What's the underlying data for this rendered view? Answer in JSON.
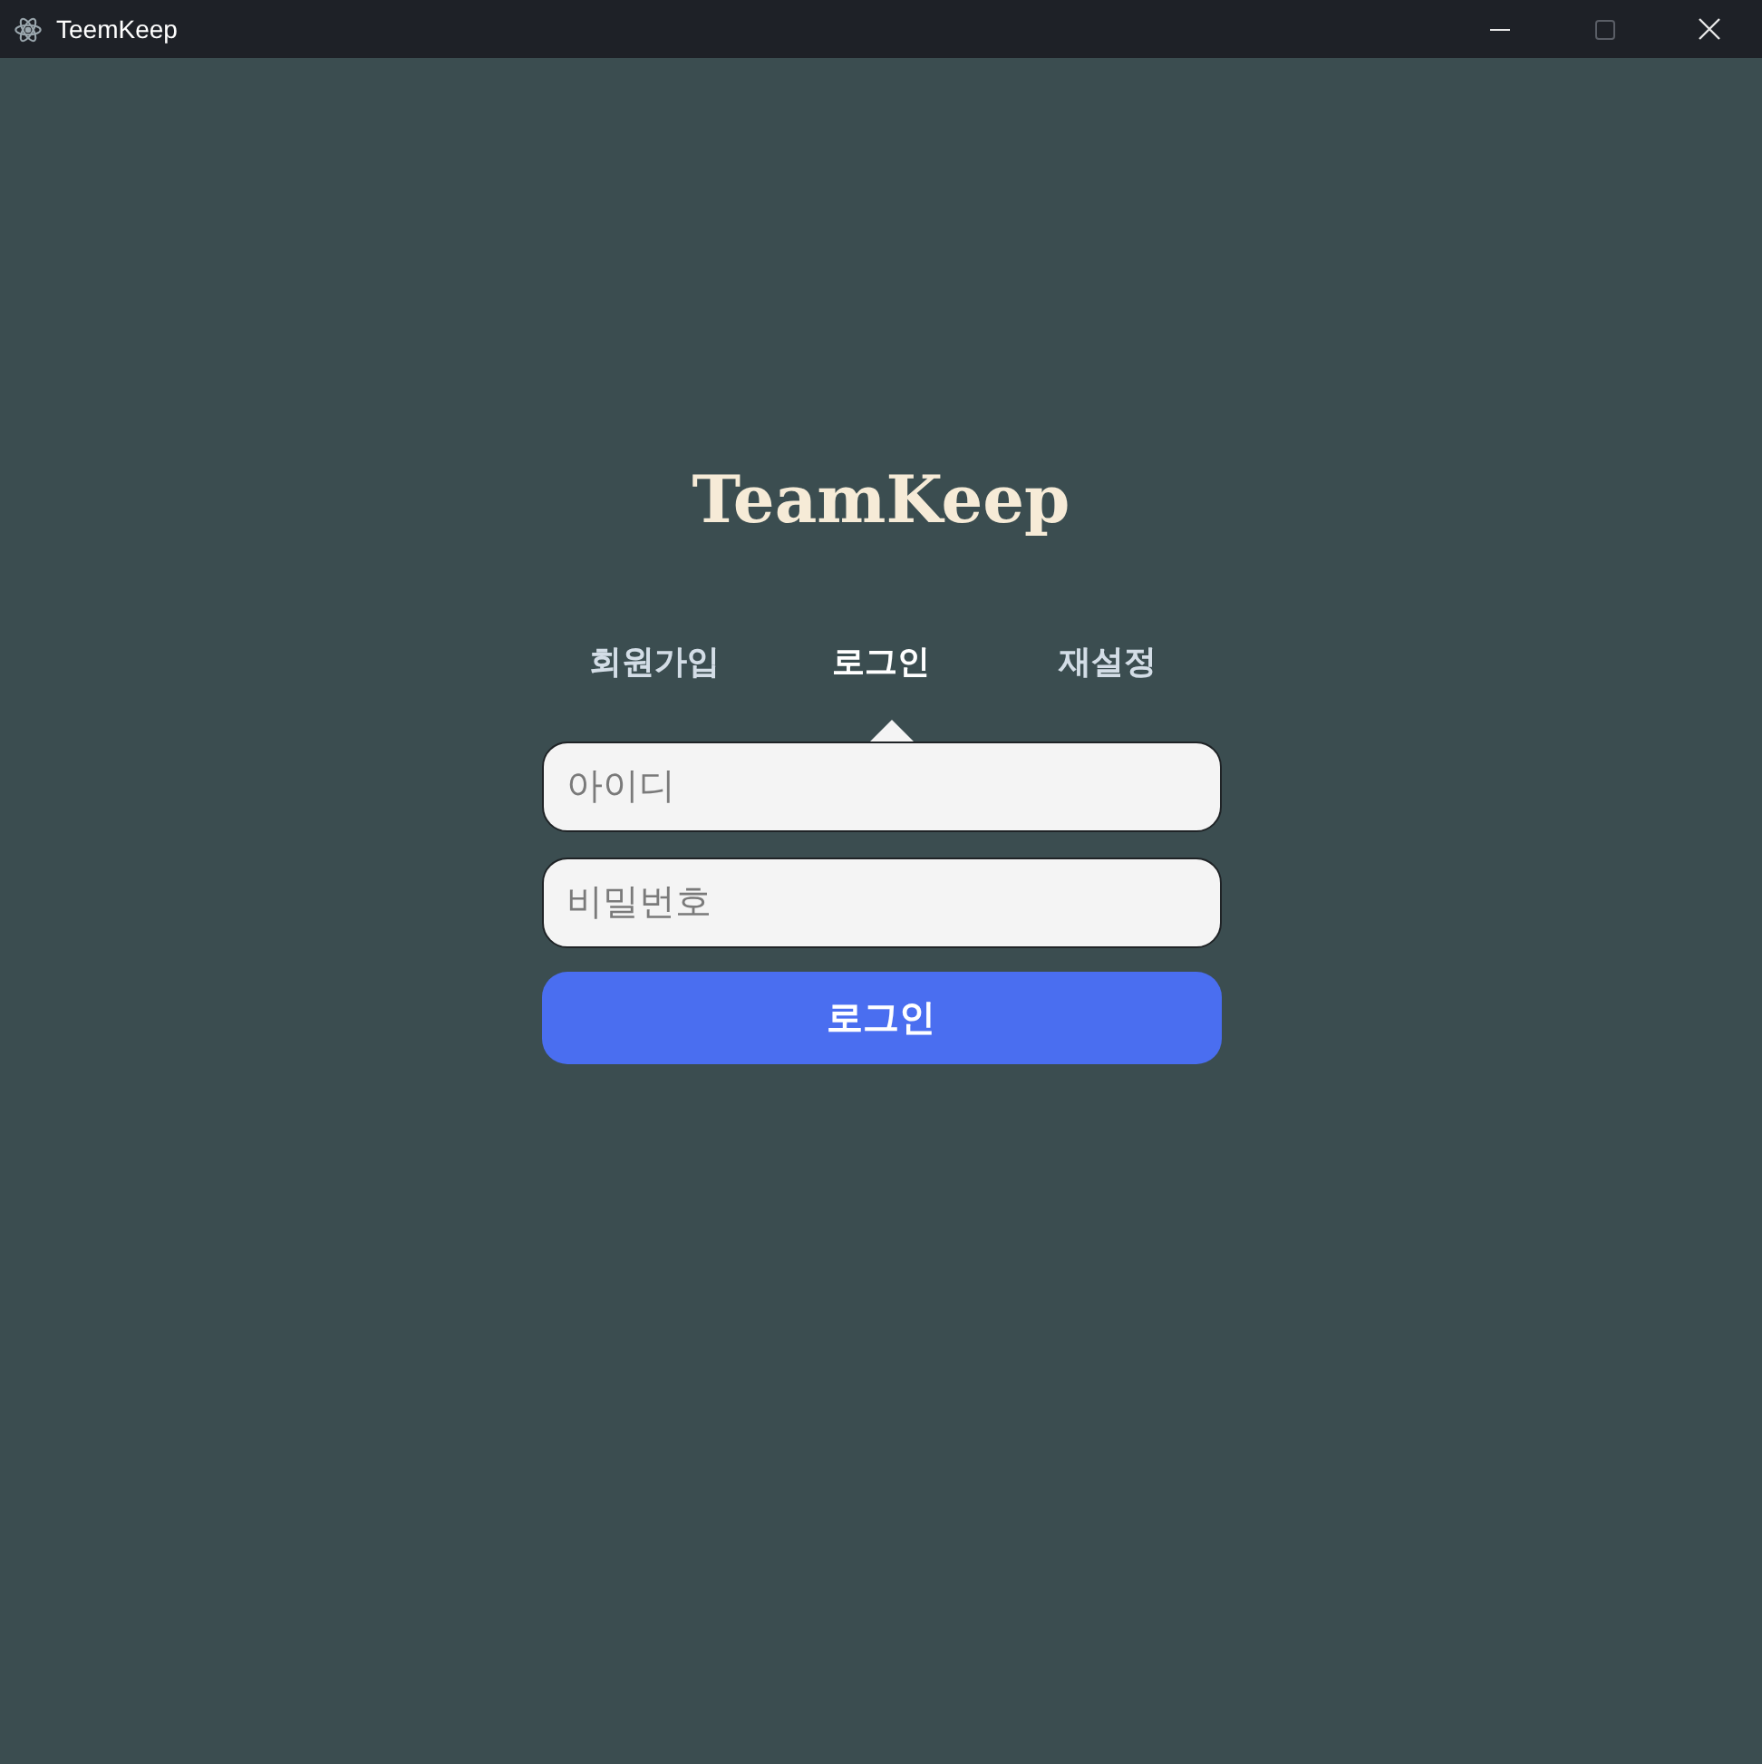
{
  "window": {
    "title": "TeemKeep",
    "controls": [
      {
        "kind": "minimize",
        "disabled": false
      },
      {
        "kind": "maximize",
        "disabled": true
      },
      {
        "kind": "close",
        "disabled": false
      }
    ]
  },
  "app_title": "TeamKeep",
  "tabs": [
    {
      "label": "회원가입",
      "selected": false
    },
    {
      "label": "로그인",
      "selected": true
    },
    {
      "label": "재설정",
      "selected": false
    }
  ],
  "fields": [
    {
      "placeholder": "아이디"
    },
    {
      "placeholder": "비밀번호"
    }
  ],
  "submit_button": {
    "label": "로그인"
  }
}
